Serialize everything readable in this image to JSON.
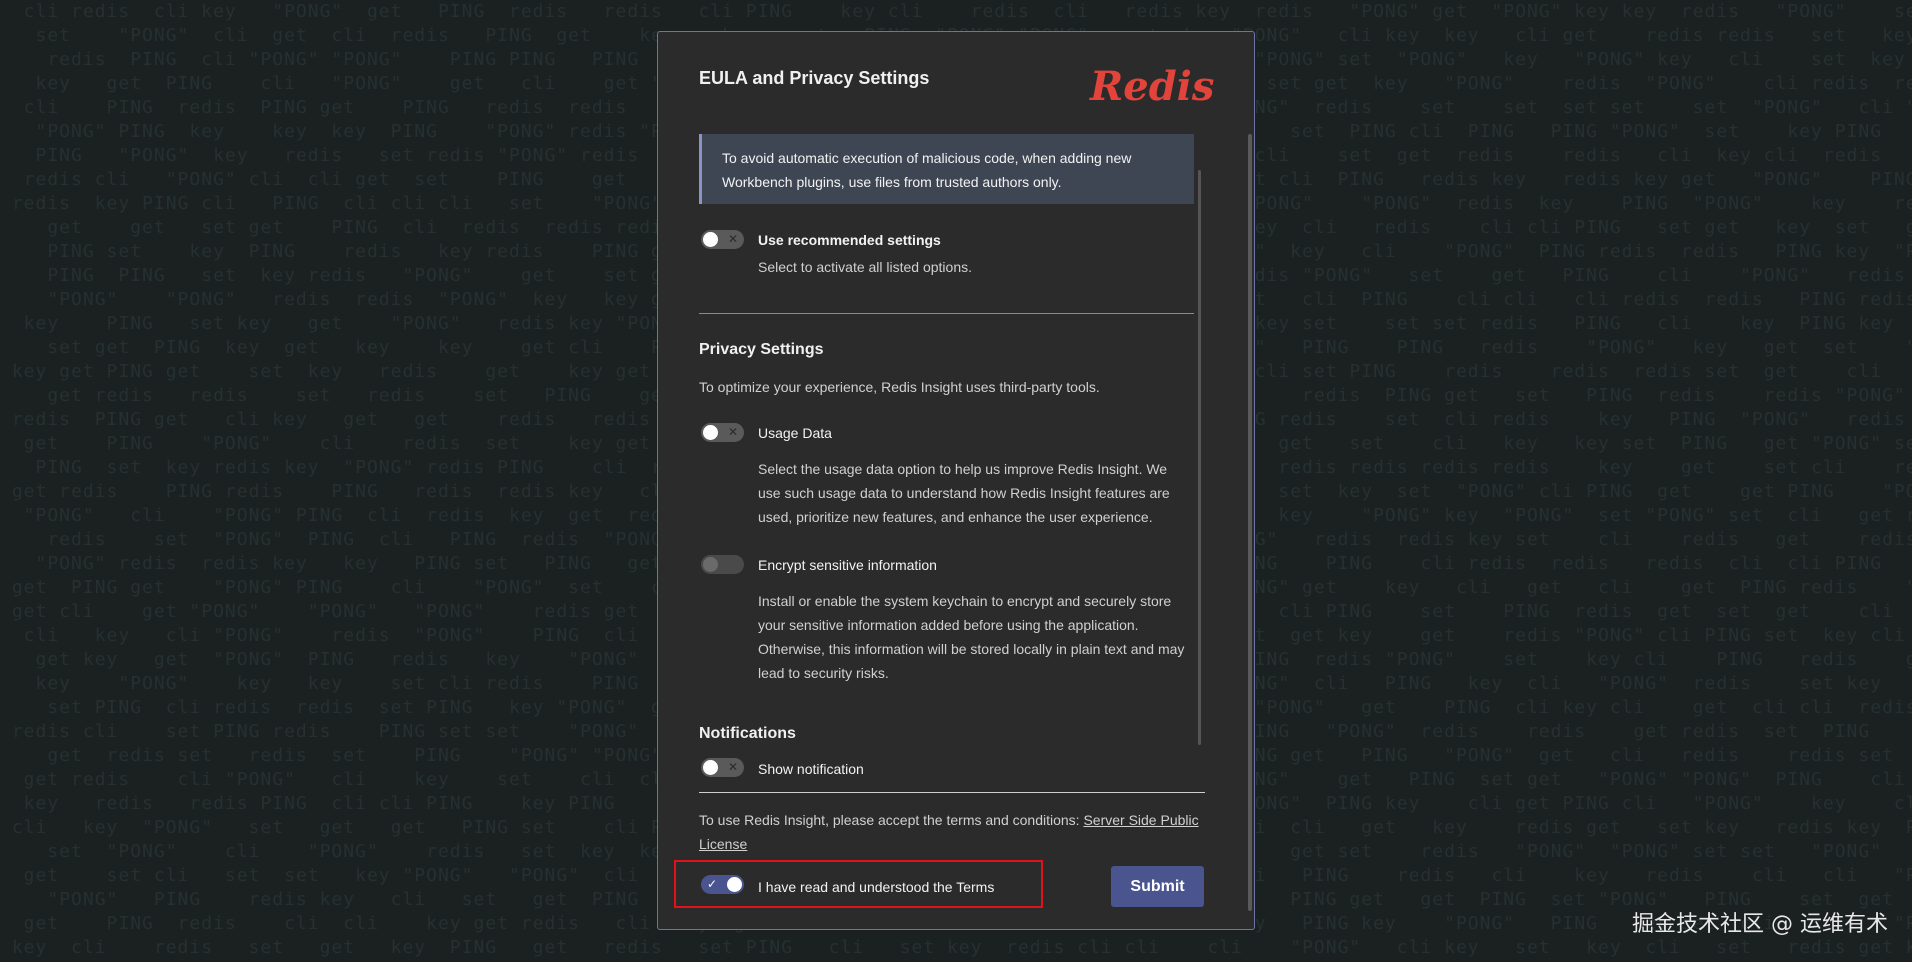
{
  "modal": {
    "title": "EULA and Privacy Settings",
    "logo_text": "Redis"
  },
  "callout": {
    "text": "To avoid automatic execution of malicious code, when adding new Workbench plugins, use files from trusted authors only."
  },
  "recommended": {
    "label": "Use recommended settings",
    "description": "Select to activate all listed options.",
    "checked": false
  },
  "privacy": {
    "title": "Privacy Settings",
    "subtitle": "To optimize your experience, Redis Insight uses third-party tools.",
    "usage": {
      "label": "Usage Data",
      "description": "Select the usage data option to help us improve Redis Insight. We use such usage data to understand how Redis Insight features are used, prioritize new features, and enhance the user experience.",
      "checked": false
    },
    "encrypt": {
      "label": "Encrypt sensitive information",
      "description": "Install or enable the system keychain to encrypt and securely store your sensitive information added before using the application. Otherwise, this information will be stored locally in plain text and may lead to security risks.",
      "checked": false,
      "disabled": true
    }
  },
  "notifications": {
    "title": "Notifications",
    "show": {
      "label": "Show notification",
      "checked": false
    }
  },
  "terms": {
    "text": "To use Redis Insight, please accept the terms and conditions: ",
    "link_text": "Server Side Public License",
    "accept_label": "I have read and understood the Terms",
    "accepted": true
  },
  "submit_label": "Submit",
  "watermark": "掘金技术社区 @ 运维有术",
  "colors": {
    "background": "#1b2121",
    "modal": "#2b2b2b",
    "accent": "#4a5590",
    "brand": "#e2433a",
    "highlight": "#e0121a"
  }
}
